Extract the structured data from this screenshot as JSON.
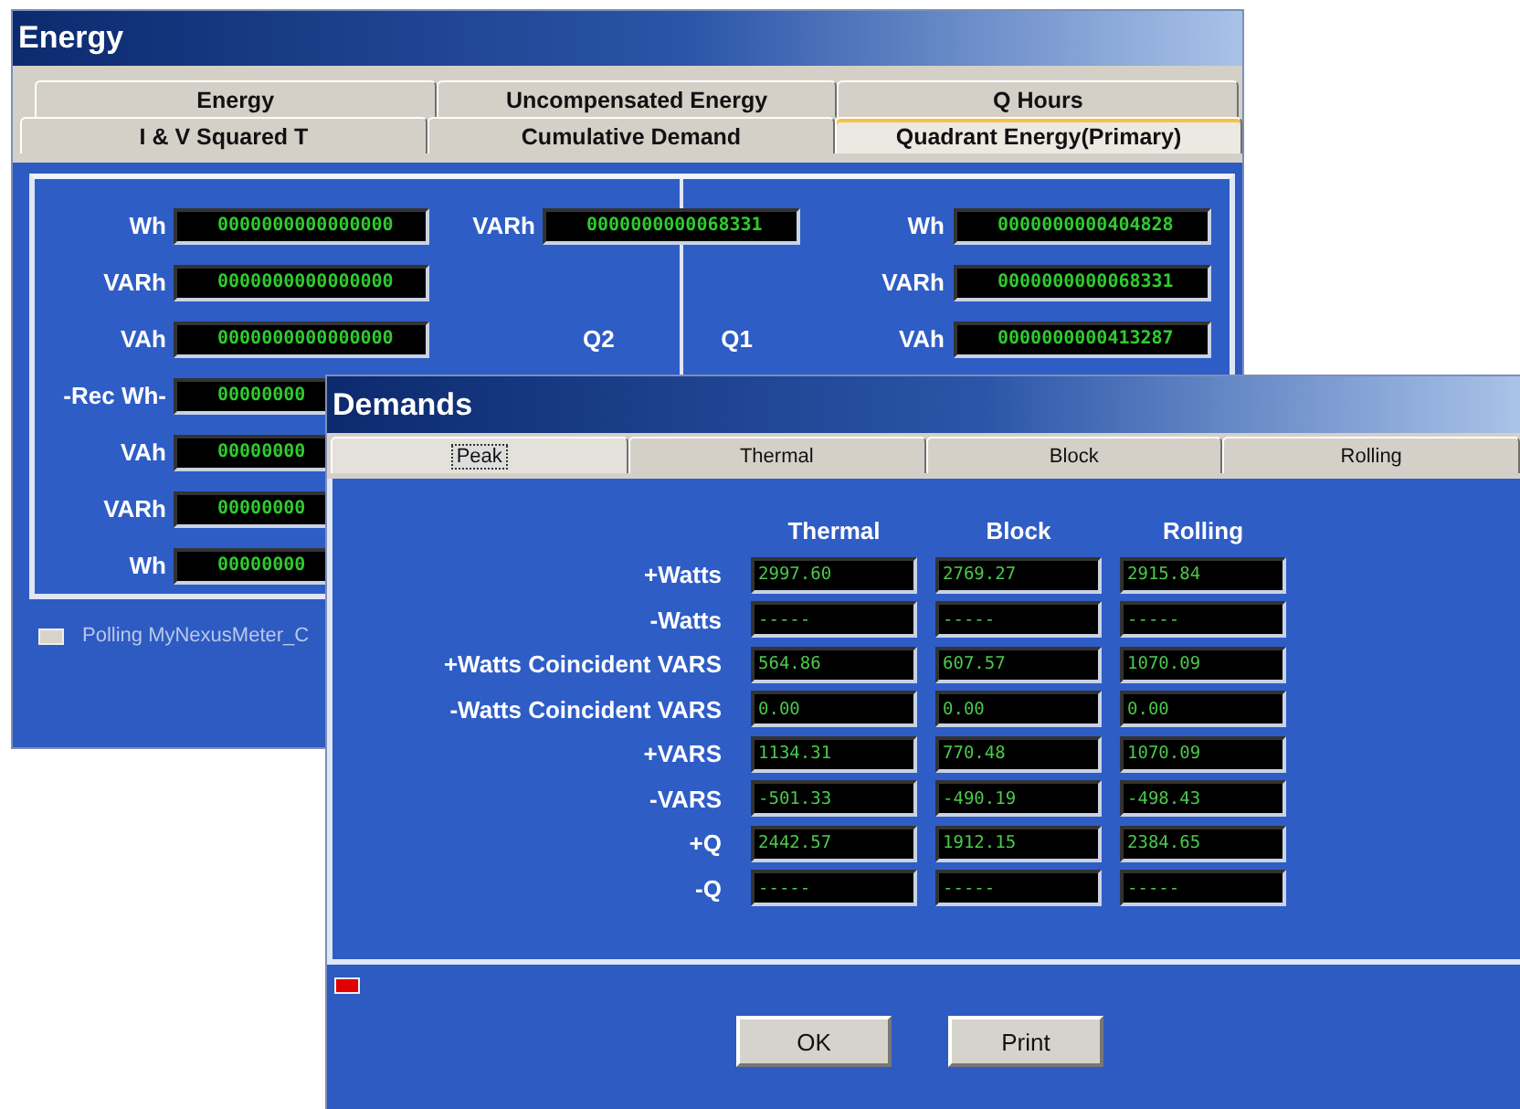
{
  "energy_window": {
    "title": "Energy",
    "tab_rows": [
      [
        {
          "label": "Energy",
          "selected": false
        },
        {
          "label": "Uncompensated Energy",
          "selected": false
        },
        {
          "label": "Q Hours",
          "selected": false
        }
      ],
      [
        {
          "label": "I & V Squared T",
          "selected": false
        },
        {
          "label": "Cumulative Demand",
          "selected": false
        },
        {
          "label": "Quadrant Energy(Primary)",
          "selected": true
        }
      ]
    ],
    "left_rows": [
      {
        "label": "Wh",
        "value": "0000000000000000"
      },
      {
        "label": "VARh",
        "value": "0000000000000000"
      },
      {
        "label": "VAh",
        "value": "0000000000000000"
      },
      {
        "label": "-Rec Wh-",
        "value": "00000000"
      },
      {
        "label": "VAh",
        "value": "00000000"
      },
      {
        "label": "VARh",
        "value": "00000000"
      },
      {
        "label": "Wh",
        "value": "00000000"
      }
    ],
    "middle_row": {
      "label": "VARh",
      "value": "0000000000068331"
    },
    "quadrants": [
      "Q2",
      "Q1"
    ],
    "right_rows": [
      {
        "label": "Wh",
        "value": "0000000000404828"
      },
      {
        "label": "VARh",
        "value": "0000000000068331"
      },
      {
        "label": "VAh",
        "value": "0000000000413287"
      }
    ],
    "status": "Polling MyNexusMeter_C"
  },
  "demands_window": {
    "title": "Demands",
    "tabs": [
      {
        "label": "Peak",
        "selected": true
      },
      {
        "label": "Thermal",
        "selected": false
      },
      {
        "label": "Block",
        "selected": false
      },
      {
        "label": "Rolling",
        "selected": false
      }
    ],
    "columns": [
      "Thermal",
      "Block",
      "Rolling"
    ],
    "rows": [
      {
        "label": "+Watts",
        "values": [
          "2997.60",
          "2769.27",
          "2915.84"
        ]
      },
      {
        "label": "-Watts",
        "values": [
          "-----",
          "-----",
          "-----"
        ]
      },
      {
        "label": "+Watts Coincident VARS",
        "values": [
          "564.86",
          "607.57",
          "1070.09"
        ]
      },
      {
        "label": "-Watts Coincident VARS",
        "values": [
          "0.00",
          "0.00",
          "0.00"
        ]
      },
      {
        "label": "+VARS",
        "values": [
          "1134.31",
          "770.48",
          "1070.09"
        ]
      },
      {
        "label": "-VARS",
        "values": [
          "-501.33",
          "-490.19",
          "-498.43"
        ]
      },
      {
        "label": "+Q",
        "values": [
          "2442.57",
          "1912.15",
          "2384.65"
        ]
      },
      {
        "label": "-Q",
        "values": [
          "-----",
          "-----",
          "-----"
        ]
      }
    ],
    "buttons": [
      "OK",
      "Print"
    ]
  }
}
